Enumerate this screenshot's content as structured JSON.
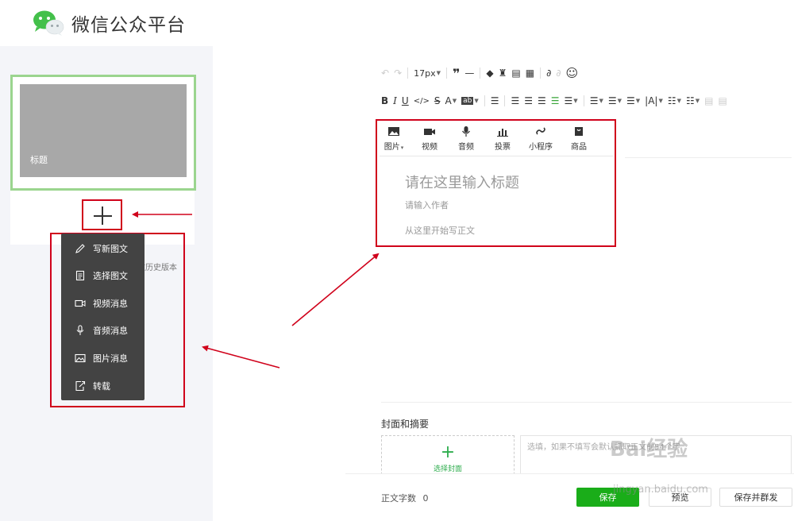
{
  "header": {
    "brand": "微信公众平台"
  },
  "left_panel": {
    "cover_title": "标题",
    "history_label": "图文历史版本",
    "menu_items": [
      {
        "label": "写新图文",
        "icon": "pencil-icon"
      },
      {
        "label": "选择图文",
        "icon": "document-icon"
      },
      {
        "label": "视频消息",
        "icon": "video-icon"
      },
      {
        "label": "音频消息",
        "icon": "microphone-icon"
      },
      {
        "label": "图片消息",
        "icon": "image-icon"
      },
      {
        "label": "转载",
        "icon": "share-icon"
      }
    ]
  },
  "toolbar": {
    "font_size": "17px",
    "format_buttons": [
      "B",
      "I",
      "U",
      "</>",
      "S",
      "A"
    ]
  },
  "insert_bar": {
    "items": [
      {
        "label": "图片",
        "icon": "image-icon",
        "has_dropdown": true
      },
      {
        "label": "视频",
        "icon": "video-icon"
      },
      {
        "label": "音频",
        "icon": "microphone-icon"
      },
      {
        "label": "投票",
        "icon": "vote-icon"
      },
      {
        "label": "小程序",
        "icon": "mini-program-icon"
      },
      {
        "label": "商品",
        "icon": "shopping-bag-icon"
      }
    ]
  },
  "editor": {
    "title_placeholder": "请在这里输入标题",
    "author_placeholder": "请输入作者",
    "body_placeholder": "从这里开始写正文"
  },
  "cover_section": {
    "title": "封面和摘要",
    "select_label": "选择封面",
    "summary_placeholder": "选填，如果不填写会默认抓取正文前54个字"
  },
  "footer": {
    "word_count_label": "正文字数",
    "word_count": "0",
    "save": "保存",
    "preview": "预览",
    "save_and_send": "保存并群发"
  },
  "watermark": {
    "main": "Bai经验",
    "sub": "jingyan.baidu.com"
  },
  "colors": {
    "accent_green": "#1aad19",
    "annotation_red": "#d0021b"
  }
}
